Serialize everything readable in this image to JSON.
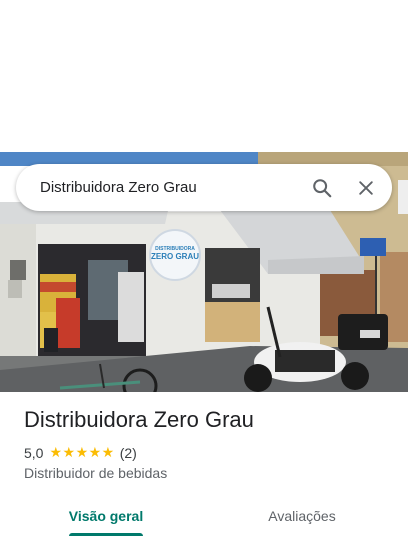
{
  "search": {
    "query": "Distribuidora Zero Grau",
    "search_icon": "search-icon",
    "clear_icon": "close-icon"
  },
  "photo": {
    "sign_text_top": "DISTRIBUIDORA",
    "sign_text_main": "ZERO GRAU"
  },
  "place": {
    "name": "Distribuidora Zero Grau",
    "rating": "5,0",
    "rating_value": 5.0,
    "stars": "★★★★★",
    "review_count": "(2)",
    "category": "Distribuidor de bebidas"
  },
  "tabs": [
    {
      "label": "Visão geral",
      "selected": true
    },
    {
      "label": "Avaliações",
      "selected": false
    }
  ],
  "colors": {
    "accent": "#00796b",
    "star": "#fbbc04",
    "text": "#202124",
    "muted": "#5f6368"
  }
}
